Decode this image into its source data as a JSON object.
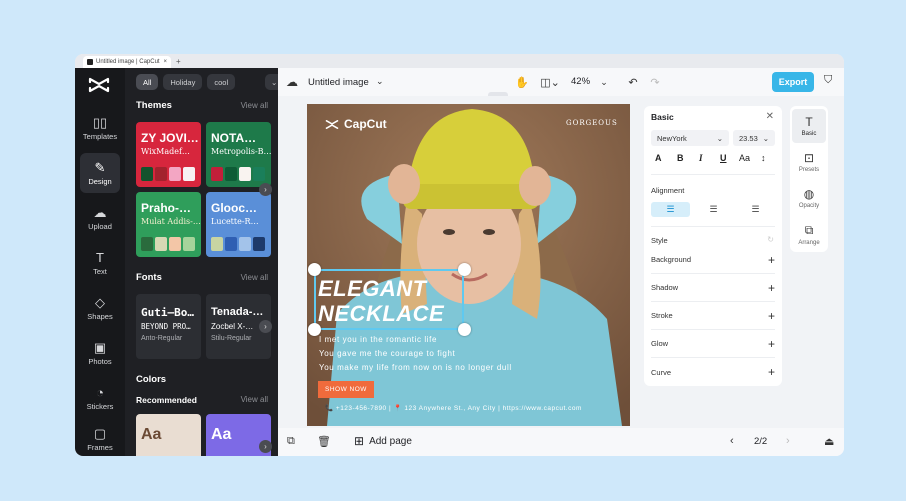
{
  "browser": {
    "tab_title": "Untitled image | CapCut",
    "tab_close": "×",
    "new_tab": "+"
  },
  "rail": {
    "items": [
      {
        "label": "Templates",
        "icon": "▯▯"
      },
      {
        "label": "Design",
        "icon": "✎"
      },
      {
        "label": "Upload",
        "icon": "☁"
      },
      {
        "label": "Text",
        "icon": "T"
      },
      {
        "label": "Shapes",
        "icon": "◇"
      },
      {
        "label": "Photos",
        "icon": "▣"
      },
      {
        "label": "Stickers",
        "icon": "◔"
      },
      {
        "label": "Frames",
        "icon": "▢"
      }
    ]
  },
  "panel": {
    "chips": [
      "All",
      "Holiday",
      "cool"
    ],
    "themes": {
      "heading": "Themes",
      "view_all": "View all",
      "cards": [
        {
          "title": "ZY JOVI…",
          "subtitle": "WixMadef…",
          "bg": "#d7263d",
          "title_color": "#ffffff",
          "sub_color": "#ffffff",
          "swatches": [
            "#14532d",
            "#a3222e",
            "#f3a6c3",
            "#f7f1f3"
          ]
        },
        {
          "title": "NOTA…",
          "subtitle": "Metropolis-B…",
          "bg": "#1e7a4a",
          "title_color": "#ffffff",
          "sub_color": "#ffffff",
          "swatches": [
            "#c21f3a",
            "#0e5c36",
            "#f9f3f0",
            "#1a7f5a"
          ]
        },
        {
          "title": "Praho-…",
          "subtitle": "Mulat Addis-…",
          "bg": "#2f9e5b",
          "title_color": "#ffffff",
          "sub_color": "#f5f0d0",
          "swatches": [
            "#2a6b3d",
            "#d6d8b4",
            "#f3c6a7",
            "#a6d49b"
          ]
        },
        {
          "title": "Glooc…",
          "subtitle": "Lucette-R…",
          "bg": "#5a8fd8",
          "title_color": "#ffffff",
          "sub_color": "#ffffff",
          "swatches": [
            "#c8d4a2",
            "#2f5fb3",
            "#a3c3ea",
            "#1d3a6b"
          ]
        }
      ]
    },
    "fonts": {
      "heading": "Fonts",
      "view_all": "View all",
      "cards": [
        {
          "a": "Guti–Bo…",
          "b": "BEYOND PRO…",
          "c": "Anto-Regular"
        },
        {
          "a": "Tenada-…",
          "b": "Zocbel X-…",
          "c": "Stilu-Regular"
        }
      ]
    },
    "colors": {
      "heading": "Colors",
      "subheading": "Recommended",
      "view_all": "View all",
      "cards": [
        {
          "label": "Aa",
          "bg": "#e9ddd2",
          "fg": "#6b4a35"
        },
        {
          "label": "Aa",
          "bg": "#7d6ae6",
          "fg": "#ffffff"
        }
      ]
    }
  },
  "topbar": {
    "title": "Untitled image",
    "zoom": "42%",
    "export": "Export"
  },
  "artboard": {
    "brand": "CapCut",
    "tagline": "GORGEOUS",
    "headline_1": "ELEGANT",
    "headline_2": "NECKLACE",
    "body": [
      "I met you in the romantic life",
      "You gave me the courage to fight",
      "You make my life from now on is no longer dull"
    ],
    "cta": "SHOW NOW",
    "contact": "📞 +123-456-7890  |  📍 123 Anywhere St., Any City  |  https://www.capcut.com"
  },
  "props": {
    "heading": "Basic",
    "font": "NewYork",
    "size": "23.53",
    "format": [
      "A",
      "B",
      "I",
      "U",
      "Aa",
      "↕"
    ],
    "alignment_label": "Alignment",
    "style_label": "Style",
    "rows": [
      "Background",
      "Shadow",
      "Stroke",
      "Glow",
      "Curve"
    ]
  },
  "right_rail": {
    "items": [
      {
        "label": "Basic",
        "icon": "T"
      },
      {
        "label": "Presets",
        "icon": "⊡"
      },
      {
        "label": "Opacity",
        "icon": "◍"
      },
      {
        "label": "Arrange",
        "icon": "⧉"
      }
    ]
  },
  "bottombar": {
    "add_page": "Add page",
    "pager": "2/2"
  }
}
